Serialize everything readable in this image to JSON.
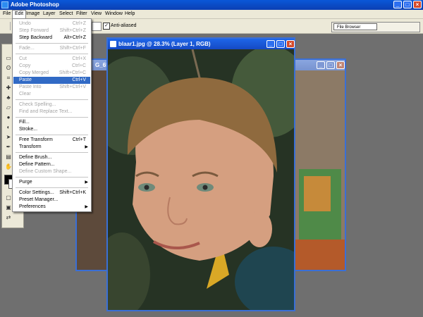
{
  "app": {
    "title": "Adobe Photoshop"
  },
  "menubar": [
    "File",
    "Edit",
    "Image",
    "Layer",
    "Select",
    "Filter",
    "View",
    "Window",
    "Help"
  ],
  "options": {
    "antialias_label": "Anti-aliased",
    "file_browser_tab": "File Browser"
  },
  "document": {
    "title": "blaar1.jpg @ 28.3% (Layer 1, RGB)"
  },
  "back_document": {
    "title_fragment": "G_65"
  },
  "edit_menu": [
    {
      "label": "Undo",
      "shortcut": "Ctrl+Z",
      "disabled": true
    },
    {
      "label": "Step Forward",
      "shortcut": "Shift+Ctrl+Z",
      "disabled": true
    },
    {
      "label": "Step Backward",
      "shortcut": "Alt+Ctrl+Z",
      "disabled": false
    },
    {
      "label": "Fade...",
      "shortcut": "Shift+Ctrl+F",
      "disabled": true
    },
    {
      "label": "Cut",
      "shortcut": "Ctrl+X",
      "disabled": true
    },
    {
      "label": "Copy",
      "shortcut": "Ctrl+C",
      "disabled": true
    },
    {
      "label": "Copy Merged",
      "shortcut": "Shift+Ctrl+C",
      "disabled": true
    },
    {
      "label": "Paste",
      "shortcut": "Ctrl+V",
      "disabled": false,
      "highlighted": true
    },
    {
      "label": "Paste Into",
      "shortcut": "Shift+Ctrl+V",
      "disabled": true
    },
    {
      "label": "Clear",
      "shortcut": "",
      "disabled": true
    },
    {
      "label": "Check Spelling...",
      "shortcut": "",
      "disabled": true
    },
    {
      "label": "Find and Replace Text...",
      "shortcut": "",
      "disabled": true
    },
    {
      "label": "Fill...",
      "shortcut": "",
      "disabled": false
    },
    {
      "label": "Stroke...",
      "shortcut": "",
      "disabled": false
    },
    {
      "label": "Free Transform",
      "shortcut": "Ctrl+T",
      "disabled": false
    },
    {
      "label": "Transform",
      "shortcut": "",
      "disabled": false,
      "submenu": true
    },
    {
      "label": "Define Brush...",
      "shortcut": "",
      "disabled": false
    },
    {
      "label": "Define Pattern...",
      "shortcut": "",
      "disabled": false
    },
    {
      "label": "Define Custom Shape...",
      "shortcut": "",
      "disabled": true
    },
    {
      "label": "Purge",
      "shortcut": "",
      "disabled": false,
      "submenu": true
    },
    {
      "label": "Color Settings...",
      "shortcut": "Shift+Ctrl+K",
      "disabled": false
    },
    {
      "label": "Preset Manager...",
      "shortcut": "",
      "disabled": false
    },
    {
      "label": "Preferences",
      "shortcut": "",
      "disabled": false,
      "submenu": true
    }
  ],
  "colors": {
    "titlebar": "#0b4fcf",
    "menu_highlight": "#316ac5",
    "workspace": "#6f6f6f"
  }
}
